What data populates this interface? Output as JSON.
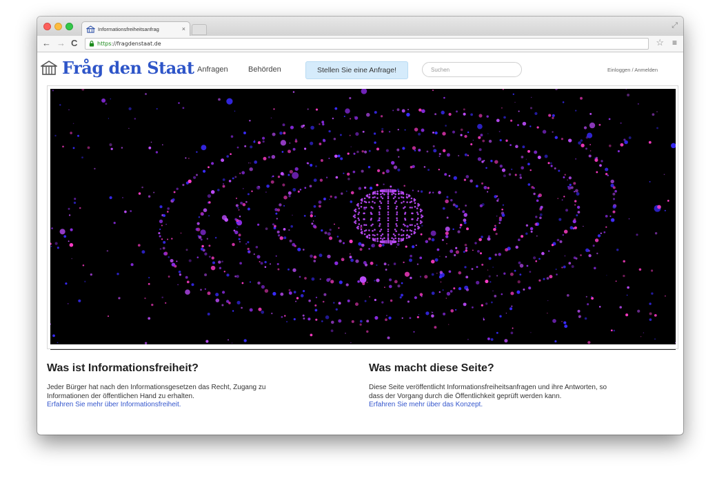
{
  "browser": {
    "tab_title": "Informationsfreiheitsanfrag",
    "tab_close": "×",
    "url_scheme": "https",
    "url_rest": "://fragdenstaat.de",
    "icons": {
      "back": "back-arrow-icon",
      "forward": "forward-arrow-icon",
      "reload": "reload-icon",
      "lock": "lock-icon",
      "star": "star-icon",
      "menu": "hamburger-menu-icon"
    }
  },
  "site": {
    "logo_text": "Fråg den Staat",
    "nav": {
      "anfragen": "Anfragen",
      "behoerden": "Behörden"
    },
    "cta_label": "Stellen Sie eine Anfrage!",
    "search_placeholder": "Suchen",
    "login_label": "Einloggen / Anmelden",
    "colors": {
      "brand": "#2e55c8",
      "cta_bg": "#d5ebfb",
      "link": "#3355cc"
    }
  },
  "info": {
    "left": {
      "heading": "Was ist Informationsfreiheit?",
      "text_line1": "Jeder Bürger hat nach den Informationsgesetzen das Recht, Zugang zu",
      "text_line2": "Informationen der öffentlichen Hand zu erhalten.",
      "link": "Erfahren Sie mehr über Informationsfreiheit."
    },
    "right": {
      "heading": "Was macht diese Seite?",
      "text_line1": "Diese Seite veröffentlicht Informationsfreiheitsanfragen und ihre Antworten, so",
      "text_line2": "dass der Vorgang durch die Öffentlichkeit geprüft werden kann.",
      "link": "Erfahren Sie mehr über das Konzept."
    }
  },
  "hero": {
    "description_colors": [
      "#8a2be2",
      "#c04dff",
      "#3a2bff",
      "#ff3cc8"
    ]
  }
}
